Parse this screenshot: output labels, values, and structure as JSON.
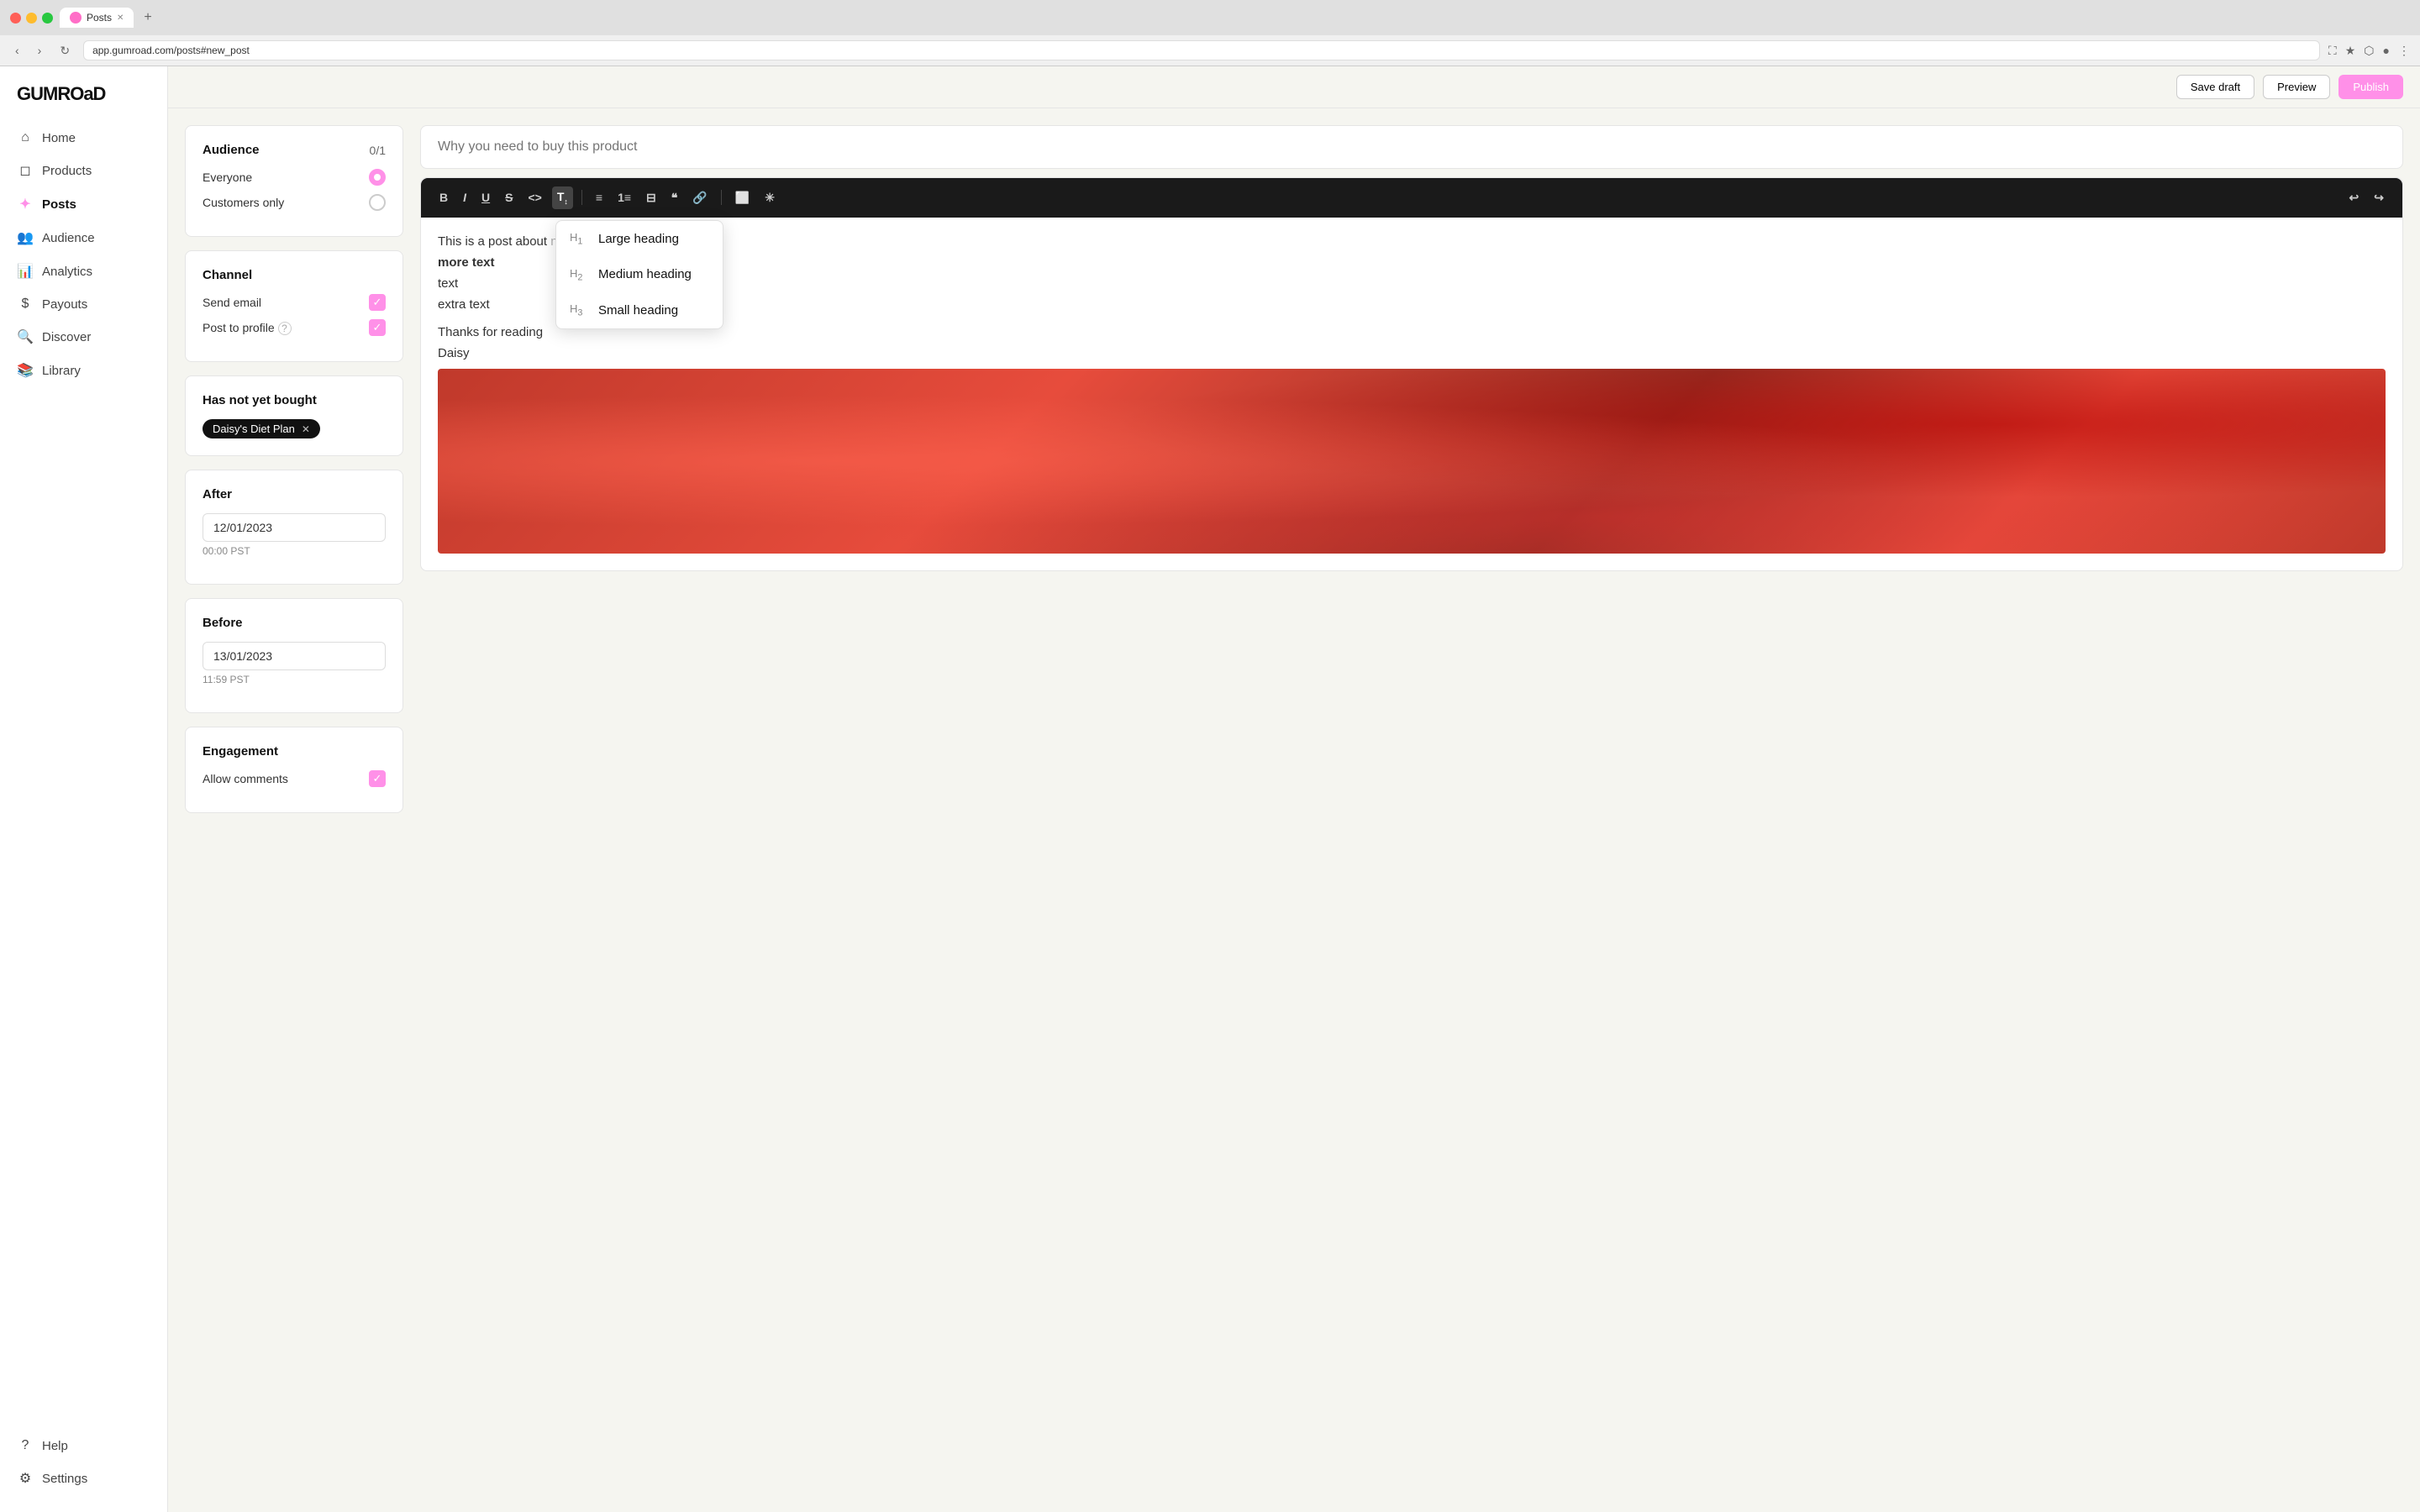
{
  "browser": {
    "tab_label": "Posts",
    "url": "app.gumroad.com/posts#new_post",
    "nav_back": "‹",
    "nav_forward": "›",
    "nav_refresh": "↻"
  },
  "topbar": {
    "btn1_label": "Save draft",
    "btn2_label": "Publish",
    "btn3_label": "Preview"
  },
  "logo": "GUMROaD",
  "nav": {
    "items": [
      {
        "id": "home",
        "label": "Home",
        "icon": "⌂",
        "active": false
      },
      {
        "id": "products",
        "label": "Products",
        "icon": "◻",
        "active": false
      },
      {
        "id": "posts",
        "label": "Posts",
        "icon": "✦",
        "active": true
      },
      {
        "id": "audience",
        "label": "Audience",
        "icon": "👥",
        "active": false
      },
      {
        "id": "analytics",
        "label": "Analytics",
        "icon": "📊",
        "active": false
      },
      {
        "id": "payouts",
        "label": "Payouts",
        "icon": "💲",
        "active": false
      },
      {
        "id": "discover",
        "label": "Discover",
        "icon": "🔍",
        "active": false
      },
      {
        "id": "library",
        "label": "Library",
        "icon": "📚",
        "active": false
      },
      {
        "id": "help",
        "label": "Help",
        "icon": "?",
        "active": false
      },
      {
        "id": "settings",
        "label": "Settings",
        "icon": "⚙",
        "active": false
      }
    ]
  },
  "settings_panel": {
    "audience_section": {
      "title": "Audience",
      "count": "0/1",
      "options": [
        {
          "label": "Everyone",
          "selected": true
        },
        {
          "label": "Customers only",
          "selected": false
        }
      ]
    },
    "channel_section": {
      "title": "Channel",
      "options": [
        {
          "label": "Send email",
          "checked": true
        },
        {
          "label": "Post to profile",
          "checked": true,
          "has_help": true
        }
      ]
    },
    "filter_section": {
      "title": "Has not yet bought",
      "tag": "Daisy's Diet Plan"
    },
    "after_section": {
      "title": "After",
      "date": "12/01/2023",
      "time": "00:00 PST"
    },
    "before_section": {
      "title": "Before",
      "date": "13/01/2023",
      "time": "11:59 PST"
    },
    "engagement_section": {
      "title": "Engagement",
      "options": [
        {
          "label": "Allow comments",
          "checked": true
        }
      ]
    }
  },
  "editor": {
    "post_title_placeholder": "Why you need to buy this product",
    "toolbar": {
      "bold": "B",
      "italic": "I",
      "underline": "U",
      "strikethrough": "S",
      "code": "<>",
      "heading": "T↕",
      "bullet": "≡",
      "ordered": "1≡",
      "align": "≡",
      "quote": "❝",
      "link": "🔗",
      "image": "⬜",
      "special": "✳",
      "undo": "↩",
      "redo": "↪"
    },
    "heading_dropdown": {
      "items": [
        {
          "tag": "H1",
          "label": "Large heading"
        },
        {
          "tag": "H2",
          "label": "Medium heading"
        },
        {
          "tag": "H3",
          "label": "Small heading"
        }
      ]
    },
    "content": {
      "line1": "This is a post about ",
      "line1_suffix": " need to buy it TODAY ☺",
      "line2": "more text",
      "line3": "text",
      "line4": "extra text",
      "line5": "Thanks for reading",
      "line6": "Daisy"
    }
  }
}
